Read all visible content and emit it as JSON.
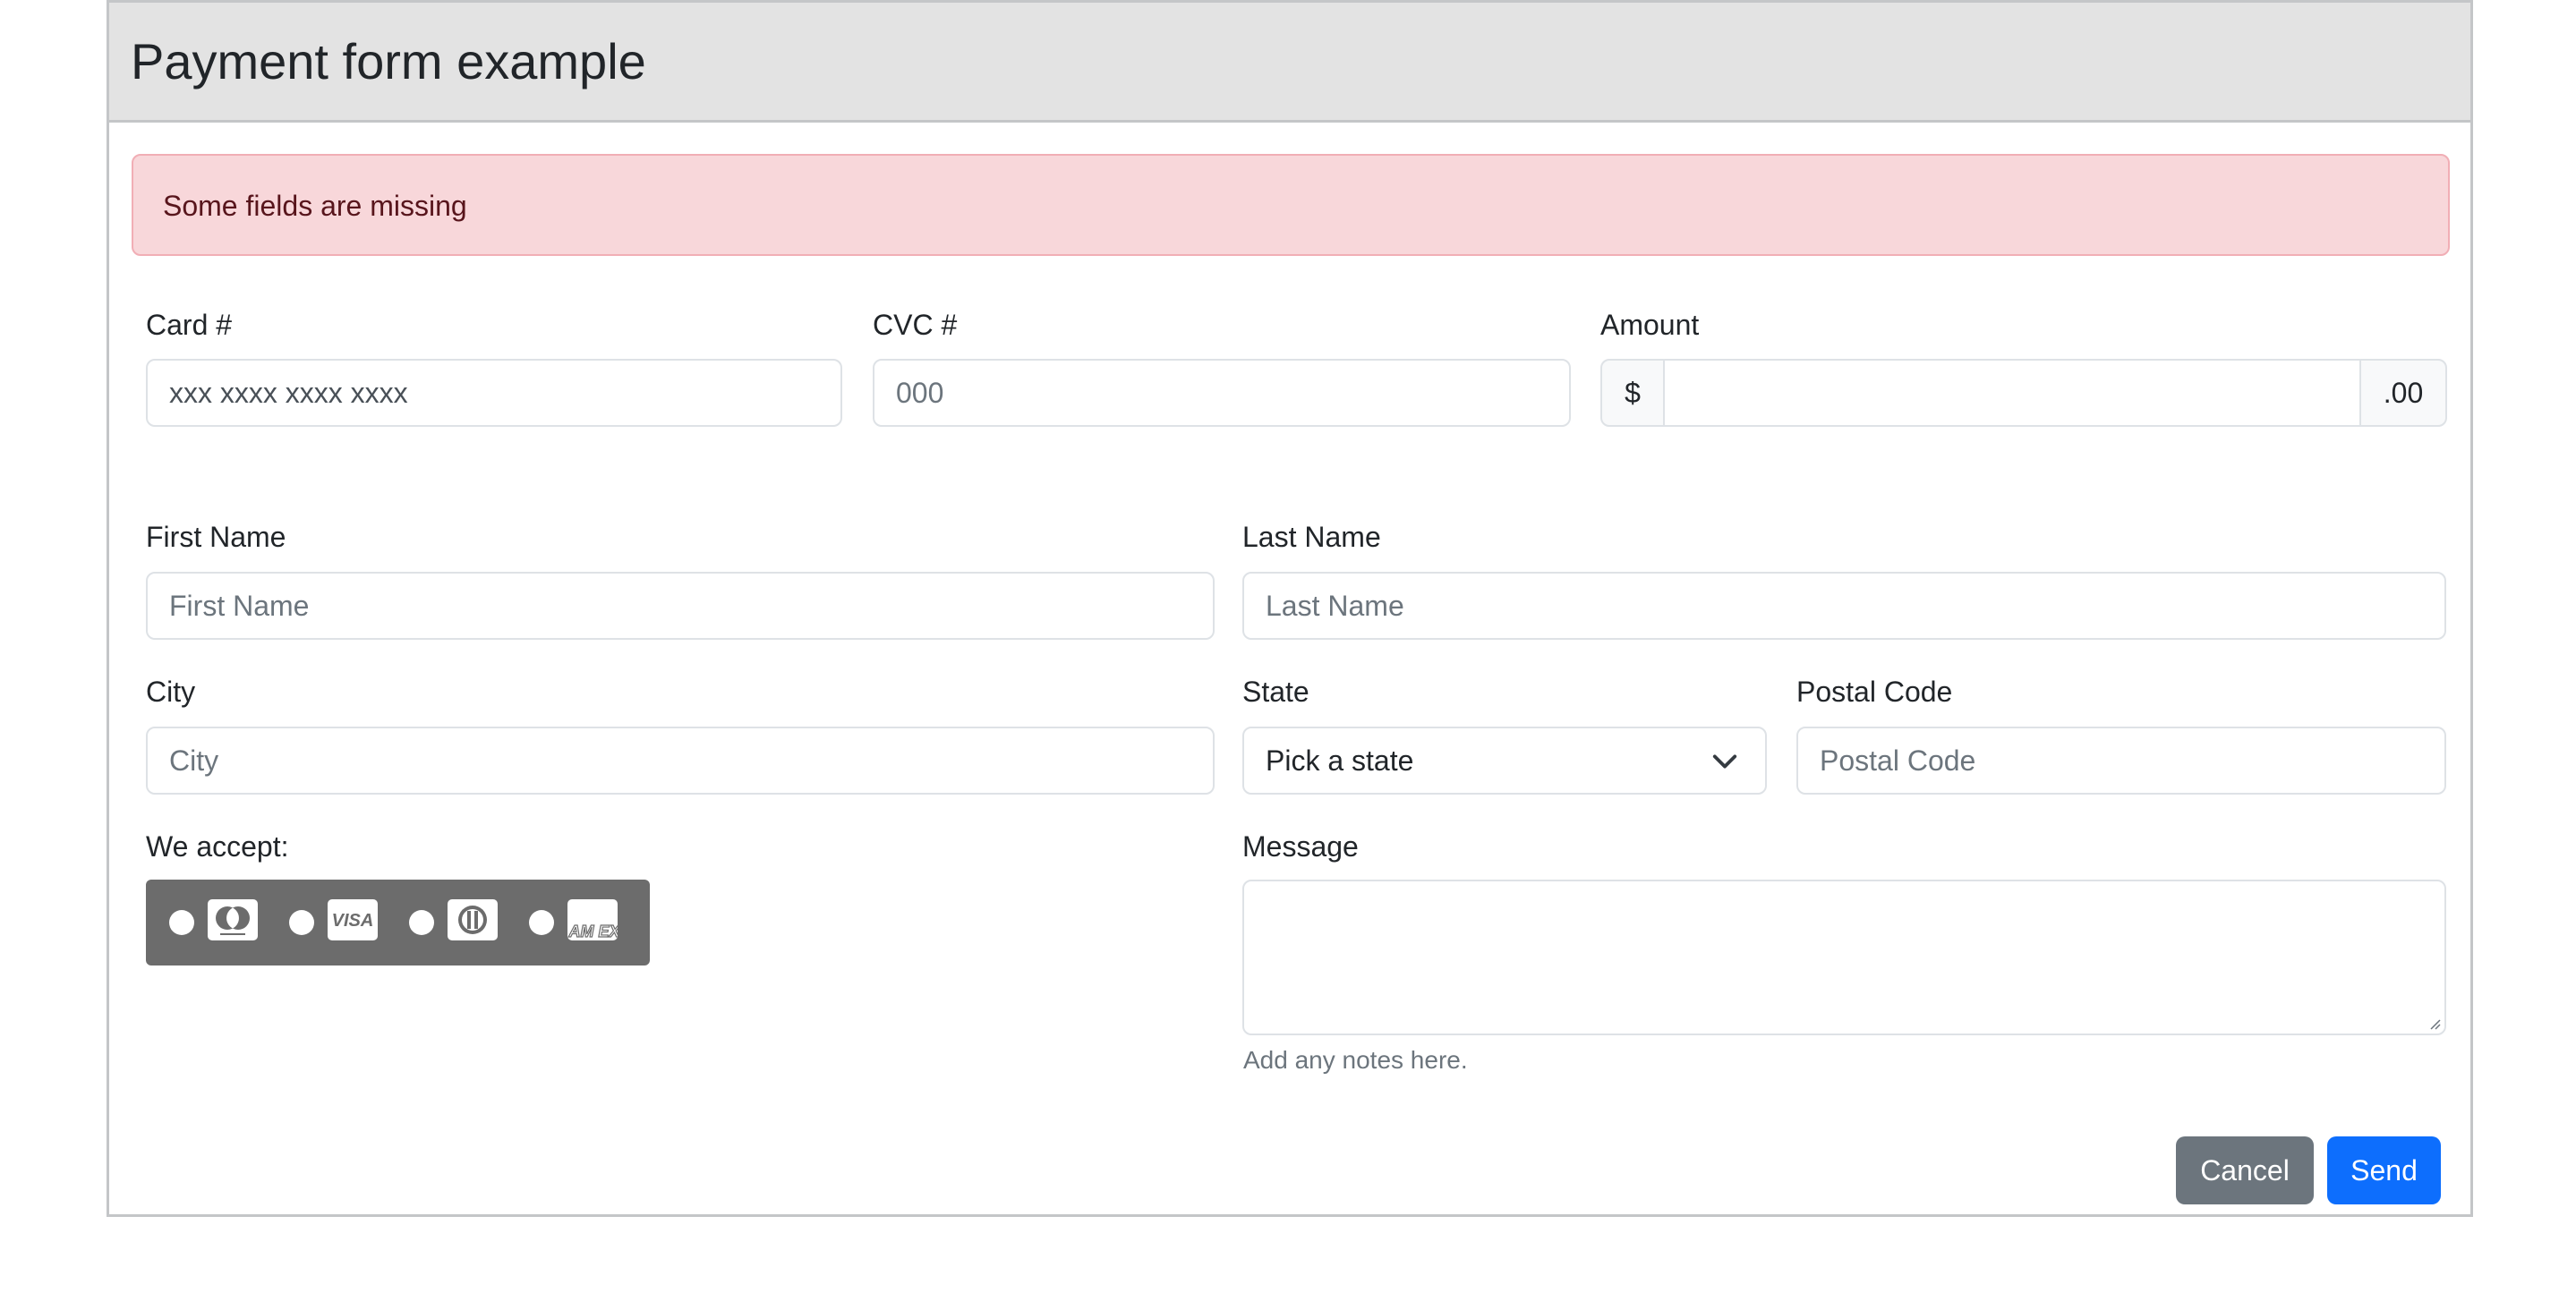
{
  "card": {
    "title": "Payment form example"
  },
  "alert": {
    "message": "Some fields are missing"
  },
  "payment": {
    "card_label": "Card #",
    "card_placeholder": "xxx xxxx xxxx xxxx",
    "cvc_label": "CVC #",
    "cvc_placeholder": "000",
    "amount_label": "Amount",
    "amount_prefix": "$",
    "amount_value": "",
    "amount_suffix": ".00"
  },
  "customer": {
    "first_name_label": "First Name",
    "first_name_placeholder": "First Name",
    "last_name_label": "Last Name",
    "last_name_placeholder": "Last Name",
    "city_label": "City",
    "city_placeholder": "City",
    "state_label": "State",
    "state_selected": "Pick a state",
    "postal_label": "Postal Code",
    "postal_placeholder": "Postal Code"
  },
  "accept": {
    "label": "We accept:",
    "cards": [
      {
        "icon": "mastercard-icon"
      },
      {
        "icon": "visa-icon",
        "text": "VISA"
      },
      {
        "icon": "diners-club-icon"
      },
      {
        "icon": "amex-icon",
        "text": "AM EX"
      }
    ]
  },
  "message": {
    "label": "Message",
    "value": "",
    "help": "Add any notes here."
  },
  "actions": {
    "cancel_label": "Cancel",
    "send_label": "Send"
  },
  "colors": {
    "primary": "#0d6efd",
    "secondary": "#6c757d",
    "alert_bg": "#f8d7da",
    "alert_text": "#58151c",
    "header_bg": "#e3e3e3",
    "accept_bg": "#6c6c6c"
  }
}
